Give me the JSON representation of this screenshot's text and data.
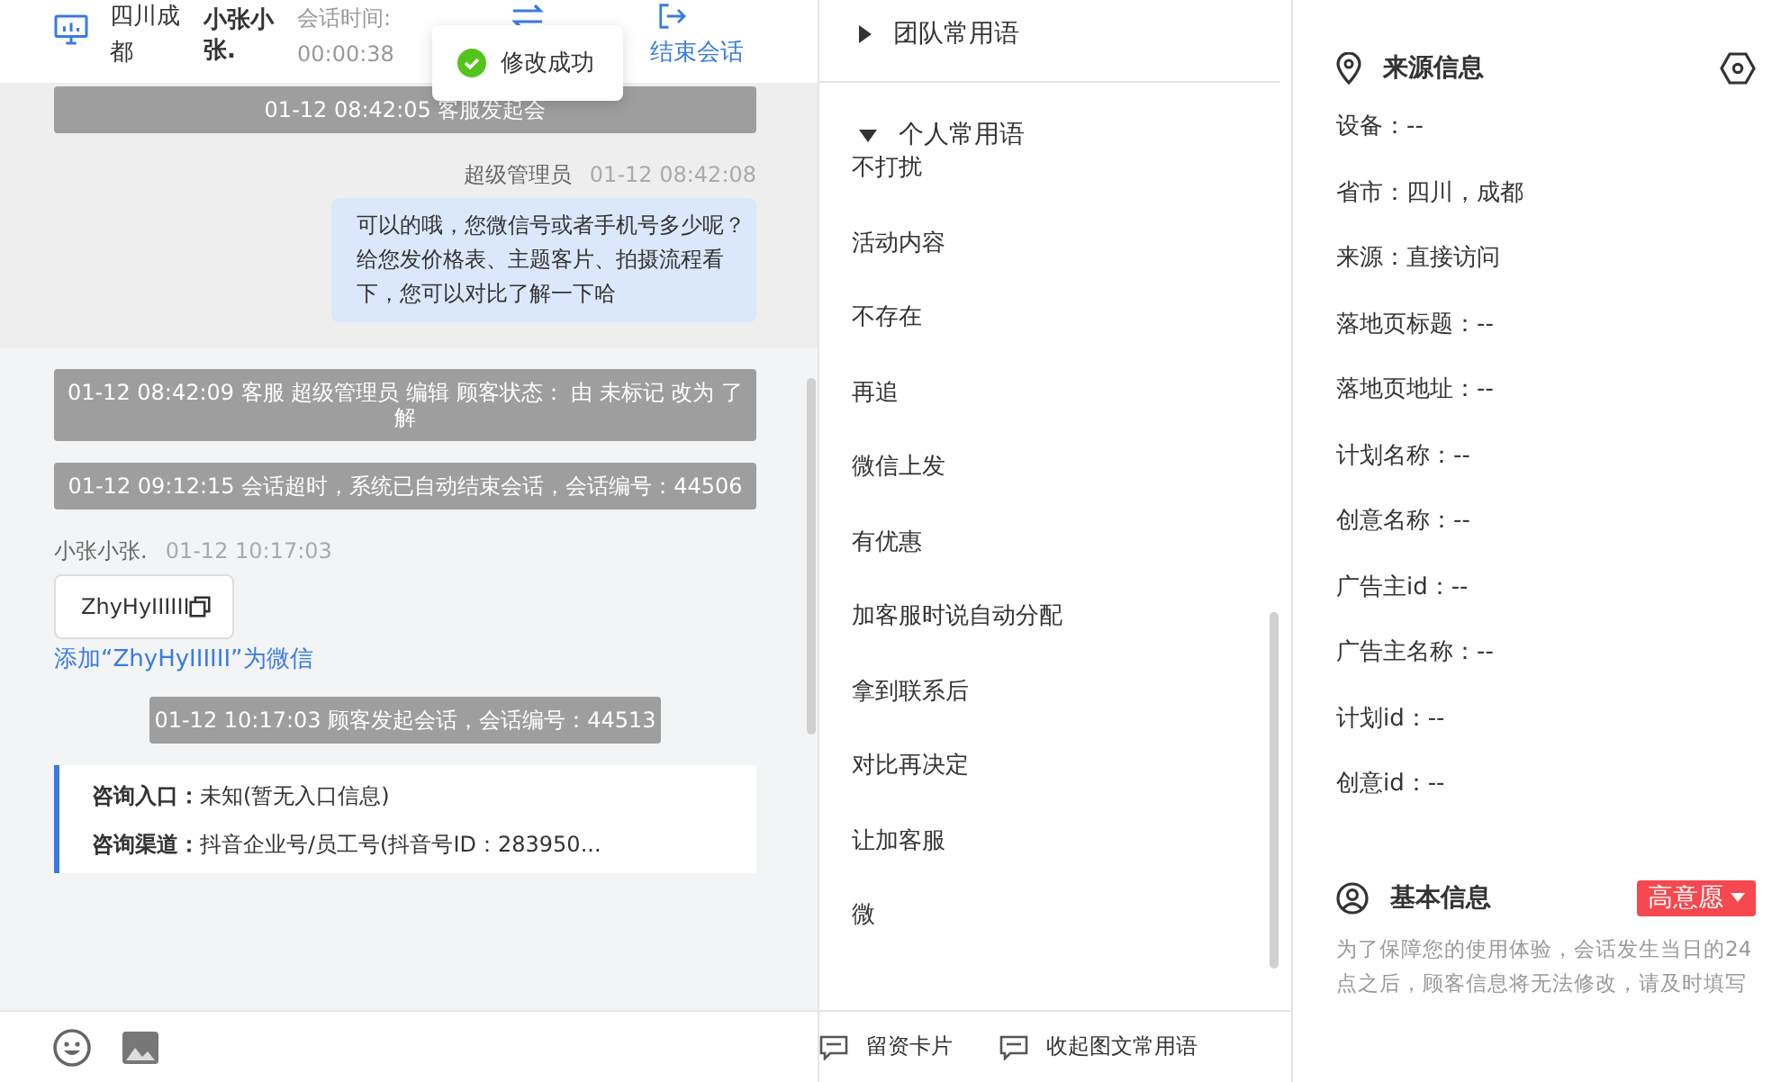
{
  "header": {
    "location": "四川成都",
    "customer": "小张小张.",
    "session_time_label": "会话时间:",
    "session_time": "00:00:38",
    "end_button": "结束会话"
  },
  "toast": {
    "message": "修改成功"
  },
  "chat": [
    {
      "kind": "system",
      "text": "01-12 08:42:05 客服发起会"
    },
    {
      "kind": "agent",
      "sender": "超级管理员",
      "time": "01-12 08:42:08",
      "text": "可以的哦，您微信号或者手机号多少呢？给您发价格表、主题客片、拍摄流程看下，您可以对比了解一下哈"
    },
    {
      "kind": "system",
      "text": "01-12 08:42:09 客服 超级管理员 编辑 顾客状态： 由 未标记 改为 了解"
    },
    {
      "kind": "system",
      "text": "01-12 09:12:15 会话超时，系统已自动结束会话，会话编号：44506"
    },
    {
      "kind": "customer",
      "sender": "小张小张.",
      "time": "01-12 10:17:03",
      "card": "ZhyHyIIIIII",
      "link": "添加“ZhyHyIIIIII”为微信"
    },
    {
      "kind": "system",
      "text": "01-12 10:17:03 顾客发起会话，会话编号：44513"
    },
    {
      "kind": "info",
      "rows": [
        {
          "label": "咨询入口：",
          "value": "未知(暂无入口信息)"
        },
        {
          "label": "咨询渠道：",
          "value": "抖音企业号/员工号(抖音号ID：283950..."
        }
      ]
    }
  ],
  "phrase_groups": [
    {
      "title": "团队常用语",
      "expanded": false
    },
    {
      "title": "个人常用语",
      "expanded": true,
      "items": [
        "不打扰",
        "活动内容",
        "不存在",
        "再追",
        "微信上发",
        "有优惠",
        "加客服时说自动分配",
        "拿到联系后",
        "对比再决定",
        "让加客服",
        "微"
      ]
    }
  ],
  "footer_actions": [
    "留资卡片",
    "收起图文常用语"
  ],
  "source_info": {
    "title": "来源信息",
    "fields": [
      "设备：--",
      "省市：四川，成都",
      "来源：直接访问",
      "落地页标题：--",
      "落地页地址：--",
      "计划名称：--",
      "创意名称：--",
      "广告主id：--",
      "广告主名称：--",
      "计划id：--",
      "创意id：--"
    ]
  },
  "basic_info": {
    "title": "基本信息",
    "tag": "高意愿",
    "note": "为了保障您的使用体验，会话发生当日的24点之后，顾客信息将无法修改，请及时填写"
  }
}
